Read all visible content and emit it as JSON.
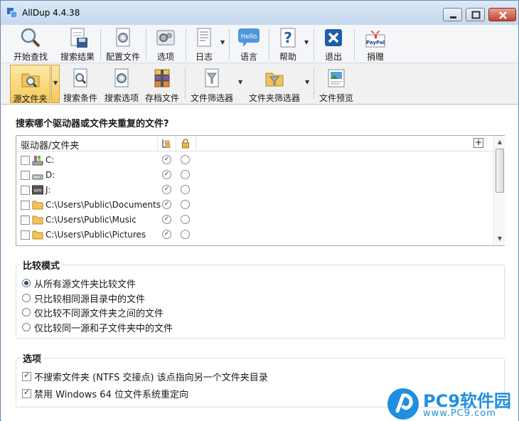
{
  "window": {
    "title": "AllDup 4.4.38"
  },
  "toolbar1": {
    "items": [
      {
        "label": "开始查找",
        "icon": "magnifier-icon"
      },
      {
        "label": "搜索结果",
        "icon": "save-results-icon"
      },
      {
        "label": "配置文件",
        "icon": "profile-file-icon"
      },
      {
        "label": "选项",
        "icon": "options-icon"
      },
      {
        "label": "日志",
        "icon": "log-icon"
      },
      {
        "label": "语言",
        "icon": "hello-bubble-icon",
        "icon_text": "Hello"
      },
      {
        "label": "帮助",
        "icon": "help-icon"
      },
      {
        "label": "退出",
        "icon": "exit-icon"
      },
      {
        "label": "捐赠",
        "icon": "paypal-gift-icon",
        "icon_text": "PayPal"
      }
    ]
  },
  "toolbar2": {
    "items": [
      {
        "label": "源文件夹",
        "icon": "source-folder-icon",
        "active": true
      },
      {
        "label": "搜索条件",
        "icon": "search-criteria-icon"
      },
      {
        "label": "搜索选项",
        "icon": "search-options-icon"
      },
      {
        "label": "存档文件",
        "icon": "archive-icon"
      },
      {
        "label": "文件筛选器",
        "icon": "file-filter-icon"
      },
      {
        "label": "文件夹筛选器",
        "icon": "folder-filter-icon"
      },
      {
        "label": "文件预览",
        "icon": "file-preview-icon"
      }
    ]
  },
  "question": "搜索哪个驱动器或文件夹重复的文件?",
  "listbox": {
    "header": "驱动器/文件夹",
    "add_button": "+",
    "rows": [
      {
        "text": "C:",
        "icon": "system-drive-icon"
      },
      {
        "text": "D:",
        "icon": "drive-icon"
      },
      {
        "text": "J:",
        "icon": "vm-drive-icon",
        "icon_text": "vm"
      },
      {
        "text": "C:\\Users\\Public\\Documents",
        "icon": "folder-icon"
      },
      {
        "text": "C:\\Users\\Public\\Music",
        "icon": "folder-icon"
      },
      {
        "text": "C:\\Users\\Public\\Pictures",
        "icon": "folder-icon"
      }
    ]
  },
  "compare_mode": {
    "title": "比较模式",
    "options": [
      {
        "label": "从所有源文件夹比较文件",
        "selected": true
      },
      {
        "label": "只比较相同源目录中的文件",
        "selected": false
      },
      {
        "label": "仅比较不同源文件夹之间的文件",
        "selected": false
      },
      {
        "label": "仅比较同一源和子文件夹中的文件",
        "selected": false
      }
    ]
  },
  "options": {
    "title": "选项",
    "items": [
      {
        "label": "不搜索文件夹 (NTFS 交接点) 该点指向另一个文件夹目录",
        "checked": true
      },
      {
        "label": "禁用 Windows 64 位文件系统重定向",
        "checked": true
      }
    ]
  },
  "watermark": {
    "text": "PC9软件园",
    "sub": "www.PC9.com"
  },
  "colors": {
    "accent": "#f5c95b",
    "title_bar": "#c4d8ee",
    "watermark": "#1f8fe0"
  }
}
